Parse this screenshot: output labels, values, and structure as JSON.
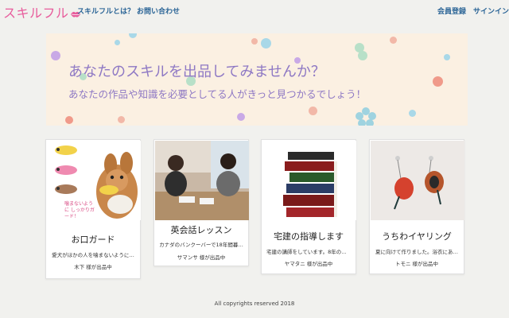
{
  "nav": {
    "brand": "スキルフル",
    "about": "スキルフルとは？",
    "contact": "お問い合わせ",
    "register": "会員登録",
    "signin": "サインイン"
  },
  "hero": {
    "title": "あなたのスキルを出品してみませんか？",
    "subtitle": "あなたの作品や知識を必要としてる人がきっと見つかるでしょう！"
  },
  "cards": [
    {
      "title": "お口ガード",
      "description": "愛犬がほかの人を噛まないように…",
      "seller": "木下 様が出品中",
      "image_caption": "噛まないように しっかりガード！"
    },
    {
      "title": "英会話レッスン",
      "description": "カナダのバンクーバーで18年間暮…",
      "seller": "サマンサ 様が出品中"
    },
    {
      "title": "宅建の指導します",
      "description": "宅建の講師をしています。8年の講…",
      "seller": "ヤマタニ 様が出品中"
    },
    {
      "title": "うちわイヤリング",
      "description": "夏に向けて作りました。浴衣にあ…",
      "seller": "トモニ 様が出品中"
    }
  ],
  "footer": "All copyrights reserved 2018",
  "colors": {
    "brand": "#e85c9c",
    "link": "#2a6496",
    "hero_text": "#8e78c4",
    "hero_bg": "#fbf0e2",
    "page_bg": "#f1f1ee"
  }
}
